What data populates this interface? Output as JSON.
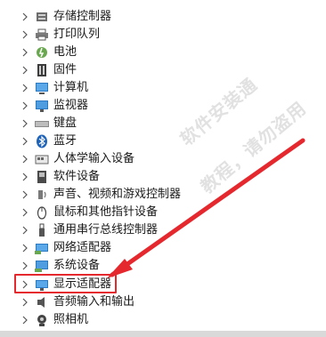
{
  "device_tree": {
    "items": [
      {
        "label": "存储控制器",
        "icon": "storage-controller-icon"
      },
      {
        "label": "打印队列",
        "icon": "printer-icon"
      },
      {
        "label": "电池",
        "icon": "battery-icon"
      },
      {
        "label": "固件",
        "icon": "firmware-icon"
      },
      {
        "label": "计算机",
        "icon": "computer-icon"
      },
      {
        "label": "监视器",
        "icon": "monitor-icon"
      },
      {
        "label": "键盘",
        "icon": "keyboard-icon"
      },
      {
        "label": "蓝牙",
        "icon": "bluetooth-icon"
      },
      {
        "label": "人体学输入设备",
        "icon": "hid-icon"
      },
      {
        "label": "软件设备",
        "icon": "software-device-icon"
      },
      {
        "label": "声音、视频和游戏控制器",
        "icon": "speaker-icon"
      },
      {
        "label": "鼠标和其他指针设备",
        "icon": "mouse-icon"
      },
      {
        "label": "通用串行总线控制器",
        "icon": "usb-icon"
      },
      {
        "label": "网络适配器",
        "icon": "network-adapter-icon"
      },
      {
        "label": "系统设备",
        "icon": "system-device-icon"
      },
      {
        "label": "显示适配器",
        "icon": "display-adapter-icon"
      },
      {
        "label": "音频输入和输出",
        "icon": "audio-io-icon"
      },
      {
        "label": "照相机",
        "icon": "camera-icon"
      }
    ],
    "selected_label": "显示适配器"
  },
  "watermark": {
    "line1": "软件安装通",
    "line2": "教程，请勿盗用"
  },
  "colors": {
    "highlight_border": "#e5282e",
    "arrow": "#e5282e",
    "icon_blue": "#2b79c2"
  }
}
